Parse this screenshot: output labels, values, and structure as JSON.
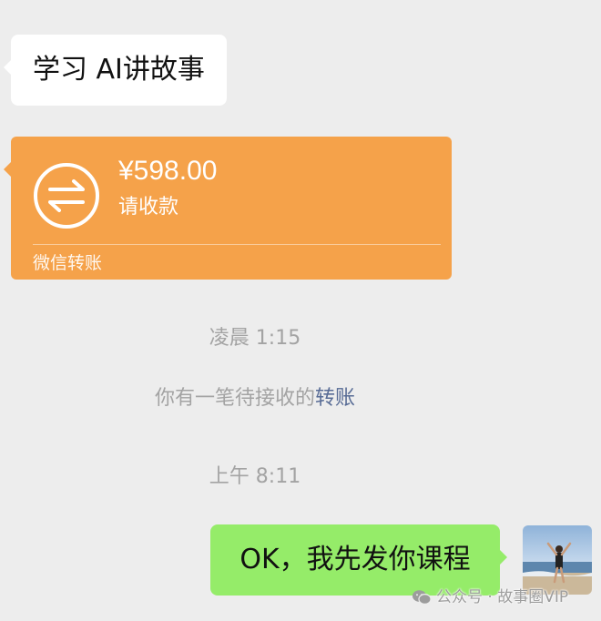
{
  "incoming_message": {
    "text": "学习 AI讲故事"
  },
  "transfer_card": {
    "amount": "¥598.00",
    "status": "请收款",
    "footer": "微信转账",
    "color": "#f5a24a",
    "icon": "transfer-arrows-icon"
  },
  "timestamp_1": "凌晨 1:15",
  "system_message": {
    "prefix": "你有一笔待接收的",
    "link": "转账"
  },
  "timestamp_2": "上午 8:11",
  "outgoing_message": {
    "text": "OK，我先发你课程"
  },
  "watermark": {
    "text": "公众号 · 故事圈VIP",
    "icon": "wechat-icon"
  },
  "colors": {
    "background": "#ededed",
    "incoming_bubble": "#ffffff",
    "outgoing_bubble": "#95ec69",
    "link": "#576b95"
  }
}
